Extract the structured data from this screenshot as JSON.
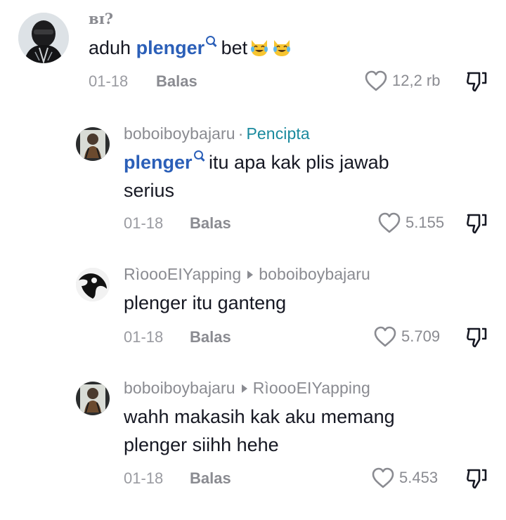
{
  "comments": [
    {
      "username": "ʙɪ?",
      "body_prefix": "aduh ",
      "tag": "plenger",
      "body_suffix": " bet",
      "emojis": [
        "laughing-cat-emoji",
        "laughing-cat-emoji"
      ],
      "date": "01-18",
      "reply_label": "Balas",
      "likes": "12,2 rb"
    },
    {
      "username": "boboiboybajaru",
      "separator": "·",
      "badge": "Pencipta",
      "tag": "plenger",
      "body_line1_suffix": " itu apa kak plis jawab",
      "body_line2": "serius",
      "date": "01-18",
      "reply_label": "Balas",
      "likes": "5.155"
    },
    {
      "username": "RìoooEIYapping",
      "reply_to": "boboiboybajaru",
      "body": "plenger itu ganteng",
      "date": "01-18",
      "reply_label": "Balas",
      "likes": "5.709"
    },
    {
      "username": "boboiboybajaru",
      "reply_to": "RìoooEIYapping",
      "body_line1": "wahh makasih kak aku memang",
      "body_line2": "plenger siihh hehe",
      "date": "01-18",
      "reply_label": "Balas",
      "likes": "5.453"
    }
  ],
  "colors": {
    "tag": "#2b5fb8",
    "creator_badge": "#1a8a9e",
    "muted": "#8a8b91"
  },
  "icons": {
    "like": "heart-outline-icon",
    "dislike": "thumbs-down-icon",
    "tag_search": "search-icon"
  }
}
